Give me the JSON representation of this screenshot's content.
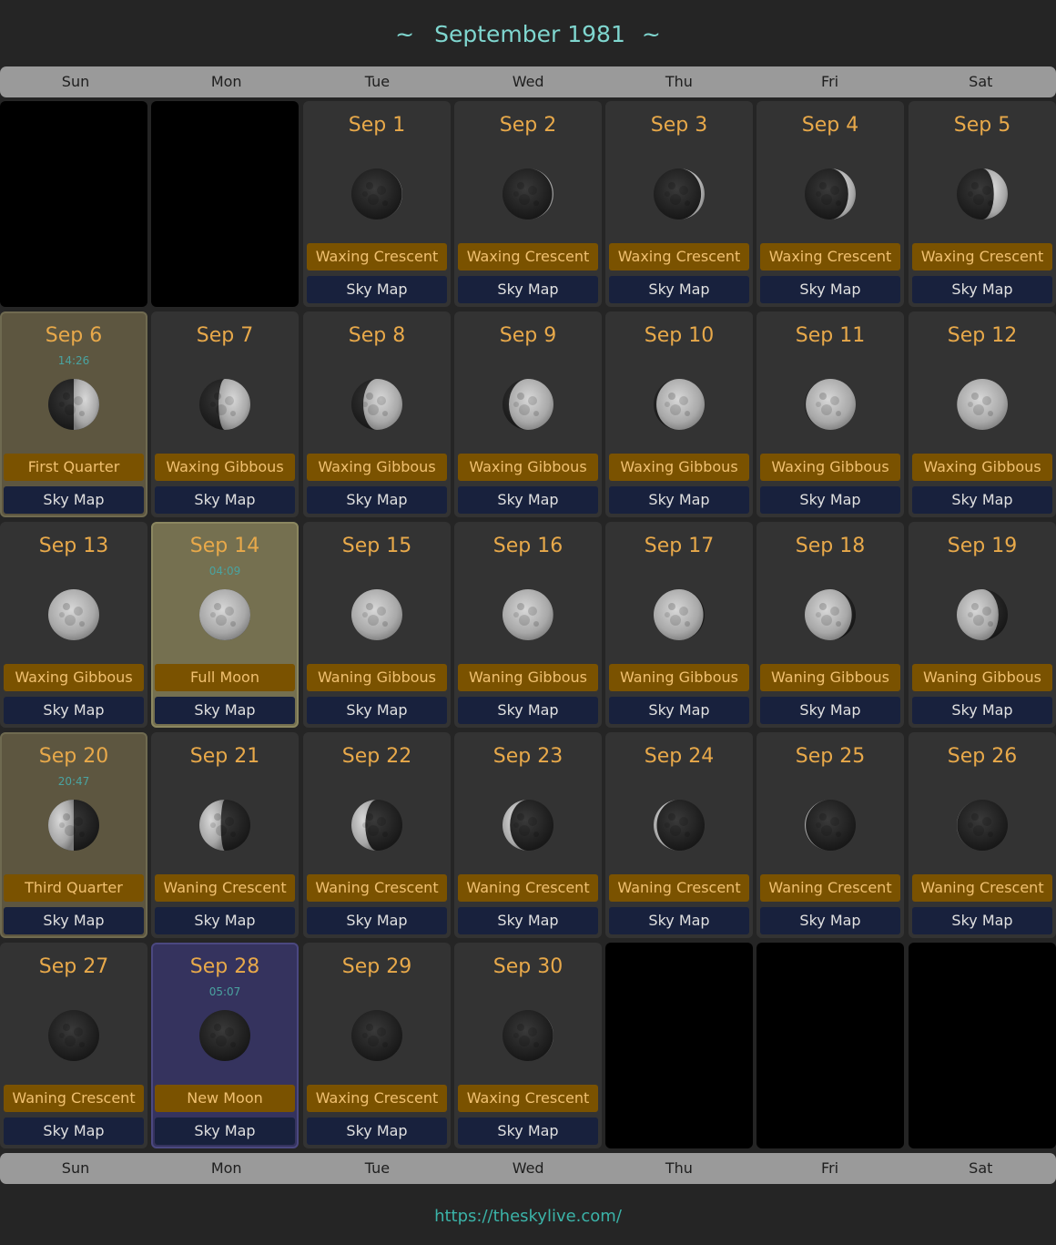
{
  "header": {
    "title": "September 1981",
    "tilde_left": "~",
    "tilde_right": "~"
  },
  "weekdays": [
    "Sun",
    "Mon",
    "Tue",
    "Wed",
    "Thu",
    "Fri",
    "Sat"
  ],
  "first_weekday_index": 2,
  "sky_map_label": "Sky Map",
  "colors": {
    "date_text": "#e8a94a",
    "phase_bg": "#7a5200",
    "skymap_bg": "#18213d",
    "quarter_highlight": "#5d5640",
    "full_highlight": "#757050",
    "new_highlight": "#35335e",
    "title": "#7fd6cf"
  },
  "days": [
    {
      "date": "Sep 1",
      "phase": "Waxing Crescent",
      "illum": 0.05,
      "waxing": true
    },
    {
      "date": "Sep 2",
      "phase": "Waxing Crescent",
      "illum": 0.1,
      "waxing": true
    },
    {
      "date": "Sep 3",
      "phase": "Waxing Crescent",
      "illum": 0.17,
      "waxing": true
    },
    {
      "date": "Sep 4",
      "phase": "Waxing Crescent",
      "illum": 0.25,
      "waxing": true
    },
    {
      "date": "Sep 5",
      "phase": "Waxing Crescent",
      "illum": 0.35,
      "waxing": true
    },
    {
      "date": "Sep 6",
      "phase": "First Quarter",
      "time": "14:26",
      "highlight": "quarter",
      "illum": 0.5,
      "waxing": true
    },
    {
      "date": "Sep 7",
      "phase": "Waxing Gibbous",
      "illum": 0.58,
      "waxing": true
    },
    {
      "date": "Sep 8",
      "phase": "Waxing Gibbous",
      "illum": 0.68,
      "waxing": true
    },
    {
      "date": "Sep 9",
      "phase": "Waxing Gibbous",
      "illum": 0.77,
      "waxing": true
    },
    {
      "date": "Sep 10",
      "phase": "Waxing Gibbous",
      "illum": 0.85,
      "waxing": true
    },
    {
      "date": "Sep 11",
      "phase": "Waxing Gibbous",
      "illum": 0.91,
      "waxing": true
    },
    {
      "date": "Sep 12",
      "phase": "Waxing Gibbous",
      "illum": 0.96,
      "waxing": true
    },
    {
      "date": "Sep 13",
      "phase": "Waxing Gibbous",
      "illum": 0.99,
      "waxing": true
    },
    {
      "date": "Sep 14",
      "phase": "Full Moon",
      "time": "04:09",
      "highlight": "full",
      "illum": 1.0,
      "waxing": true
    },
    {
      "date": "Sep 15",
      "phase": "Waning Gibbous",
      "illum": 0.99,
      "waxing": false
    },
    {
      "date": "Sep 16",
      "phase": "Waning Gibbous",
      "illum": 0.96,
      "waxing": false
    },
    {
      "date": "Sep 17",
      "phase": "Waning Gibbous",
      "illum": 0.9,
      "waxing": false
    },
    {
      "date": "Sep 18",
      "phase": "Waning Gibbous",
      "illum": 0.82,
      "waxing": false
    },
    {
      "date": "Sep 19",
      "phase": "Waning Gibbous",
      "illum": 0.72,
      "waxing": false
    },
    {
      "date": "Sep 20",
      "phase": "Third Quarter",
      "time": "20:47",
      "highlight": "quarter",
      "illum": 0.5,
      "waxing": false
    },
    {
      "date": "Sep 21",
      "phase": "Waning Crescent",
      "illum": 0.45,
      "waxing": false
    },
    {
      "date": "Sep 22",
      "phase": "Waning Crescent",
      "illum": 0.35,
      "waxing": false
    },
    {
      "date": "Sep 23",
      "phase": "Waning Crescent",
      "illum": 0.25,
      "waxing": false
    },
    {
      "date": "Sep 24",
      "phase": "Waning Crescent",
      "illum": 0.16,
      "waxing": false
    },
    {
      "date": "Sep 25",
      "phase": "Waning Crescent",
      "illum": 0.09,
      "waxing": false
    },
    {
      "date": "Sep 26",
      "phase": "Waning Crescent",
      "illum": 0.04,
      "waxing": false
    },
    {
      "date": "Sep 27",
      "phase": "Waning Crescent",
      "illum": 0.01,
      "waxing": false
    },
    {
      "date": "Sep 28",
      "phase": "New Moon",
      "time": "05:07",
      "highlight": "new",
      "illum": 0.0,
      "waxing": true
    },
    {
      "date": "Sep 29",
      "phase": "Waxing Crescent",
      "illum": 0.01,
      "waxing": true
    },
    {
      "date": "Sep 30",
      "phase": "Waxing Crescent",
      "illum": 0.04,
      "waxing": true
    }
  ],
  "footer": {
    "link_text": "https://theskylive.com/"
  }
}
